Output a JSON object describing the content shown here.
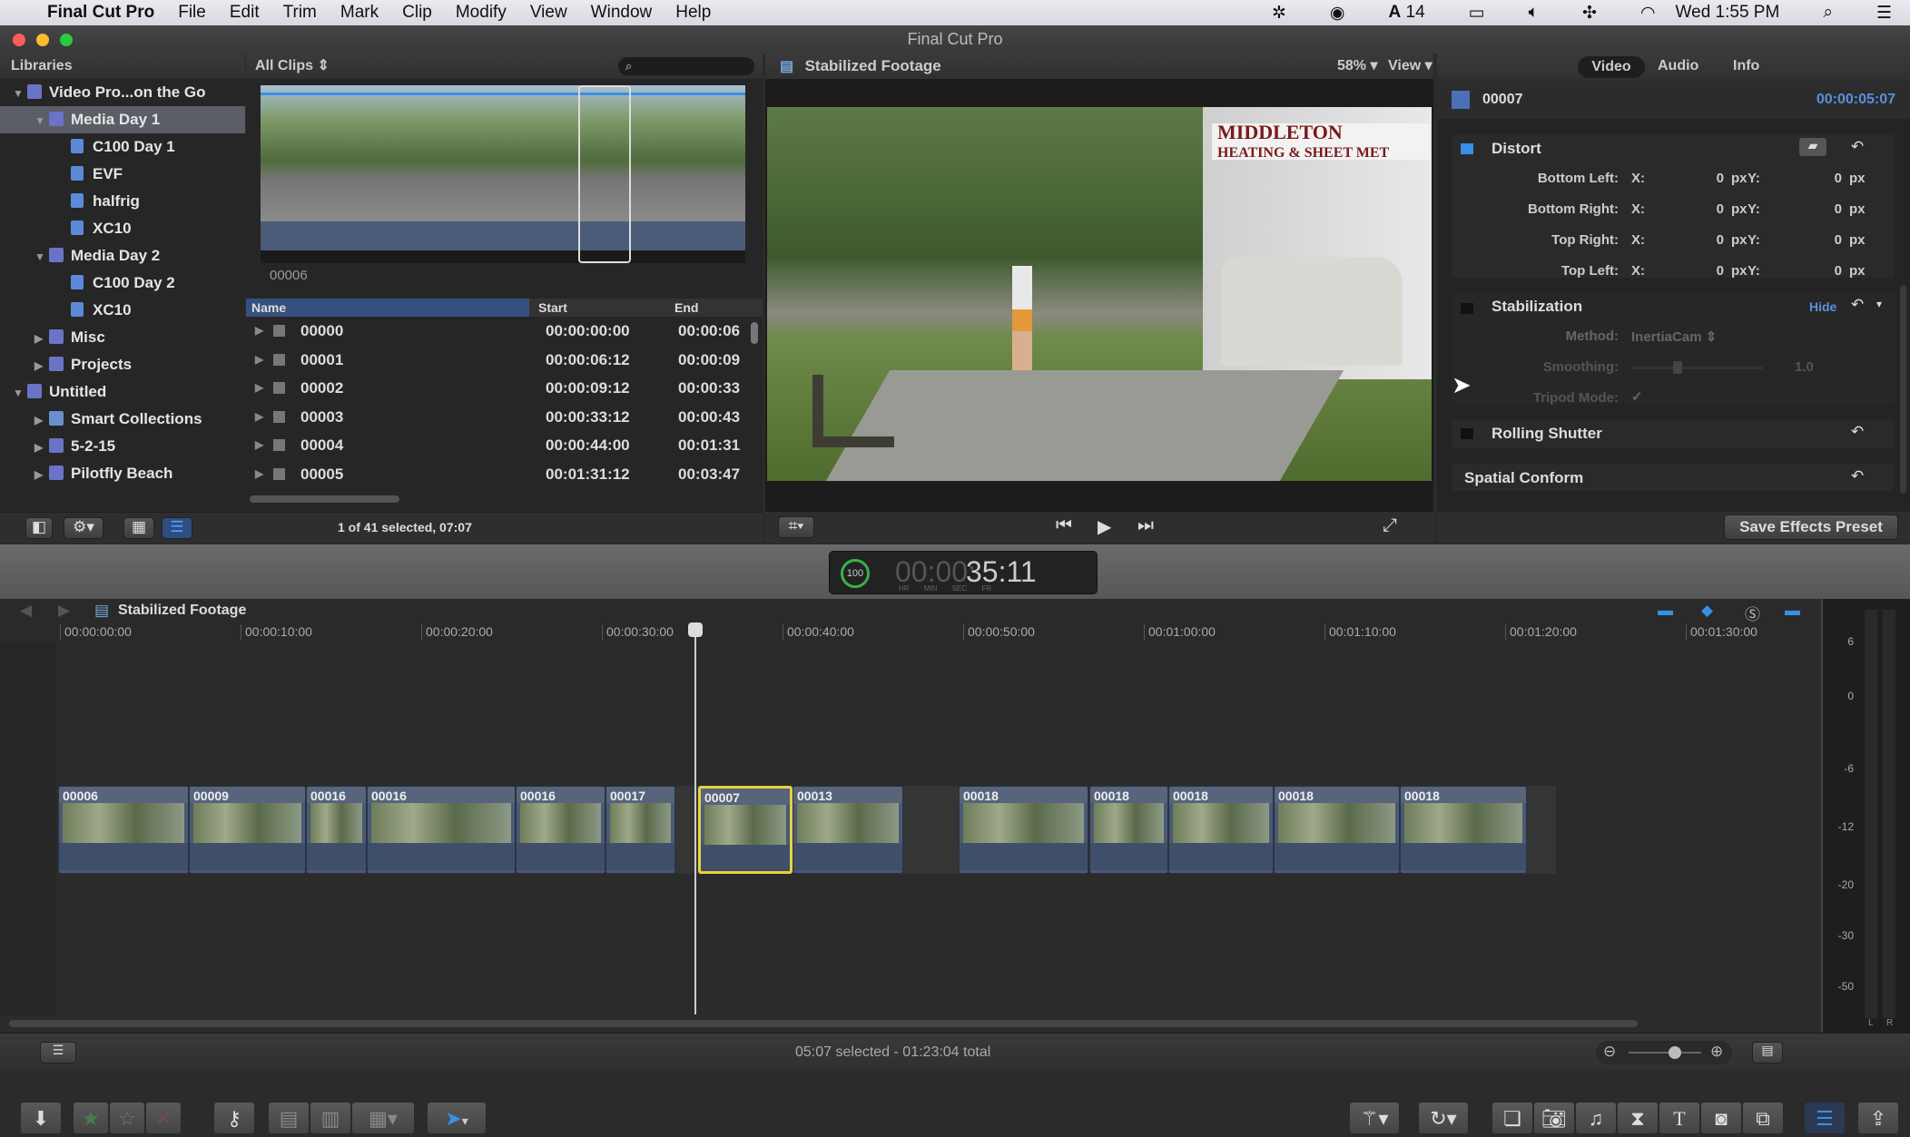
{
  "menubar": {
    "apple": "",
    "app": "Final Cut Pro",
    "items": [
      "File",
      "Edit",
      "Trim",
      "Mark",
      "Clip",
      "Modify",
      "View",
      "Window",
      "Help"
    ],
    "adobe_count": "14",
    "clock": "Wed 1:55 PM"
  },
  "window": {
    "title": "Final Cut Pro"
  },
  "libraries": {
    "header": "Libraries",
    "items": [
      {
        "label": "Video Pro...on the Go",
        "type": "library",
        "level": 0,
        "open": true
      },
      {
        "label": "Media Day 1",
        "type": "event-group",
        "level": 1,
        "open": true,
        "selected": true
      },
      {
        "label": "C100 Day 1",
        "type": "event",
        "level": 2
      },
      {
        "label": "EVF",
        "type": "event",
        "level": 2
      },
      {
        "label": "halfrig",
        "type": "event",
        "level": 2
      },
      {
        "label": "XC10",
        "type": "event",
        "level": 2
      },
      {
        "label": "Media Day 2",
        "type": "event-group",
        "level": 1,
        "open": true
      },
      {
        "label": "C100 Day 2",
        "type": "event",
        "level": 2
      },
      {
        "label": "XC10",
        "type": "event",
        "level": 2
      },
      {
        "label": "Misc",
        "type": "event-group",
        "level": 1
      },
      {
        "label": "Projects",
        "type": "event-group",
        "level": 1
      },
      {
        "label": "Untitled",
        "type": "library",
        "level": 0,
        "open": true
      },
      {
        "label": "Smart Collections",
        "type": "folder",
        "level": 1
      },
      {
        "label": "5-2-15",
        "type": "event-group",
        "level": 1
      },
      {
        "label": "Pilotfly Beach",
        "type": "event-group",
        "level": 1
      }
    ]
  },
  "browser": {
    "filter": "All Clips",
    "search_placeholder": "",
    "filmstrip_label": "00006",
    "columns": [
      "Name",
      "Start",
      "End"
    ],
    "rows": [
      [
        "00000",
        "00:00:00:00",
        "00:00:06"
      ],
      [
        "00001",
        "00:00:06:12",
        "00:00:09"
      ],
      [
        "00002",
        "00:00:09:12",
        "00:00:33"
      ],
      [
        "00003",
        "00:00:33:12",
        "00:00:43"
      ],
      [
        "00004",
        "00:00:44:00",
        "00:01:31"
      ],
      [
        "00005",
        "00:01:31:12",
        "00:03:47"
      ]
    ],
    "status": "1 of 41 selected, 07:07"
  },
  "viewer": {
    "title": "Stabilized Footage",
    "zoom": "58%",
    "view_label": "View"
  },
  "inspector": {
    "tabs": [
      "Video",
      "Audio",
      "Info"
    ],
    "active_tab": "Video",
    "clip_name": "00007",
    "duration": "00:00:05:07",
    "distort": {
      "title": "Distort",
      "rows": [
        {
          "label": "Bottom Left:",
          "x": "0",
          "y": "0"
        },
        {
          "label": "Bottom Right:",
          "x": "0",
          "y": "0"
        },
        {
          "label": "Top Right:",
          "x": "0",
          "y": "0"
        },
        {
          "label": "Top Left:",
          "x": "0",
          "y": "0"
        }
      ],
      "x_label": "X:",
      "y_label": "Y:",
      "unit": "px"
    },
    "stabilization": {
      "title": "Stabilization",
      "hide": "Hide",
      "method_label": "Method:",
      "method": "InertiaCam",
      "smoothing_label": "Smoothing:",
      "smoothing": "1.0",
      "smoothing_fraction": 0.35,
      "tripod_label": "Tripod Mode:",
      "tripod": "✓"
    },
    "rolling_shutter": "Rolling Shutter",
    "spatial_conform": "Spatial Conform",
    "save_preset": "Save Effects Preset"
  },
  "toolbar": {
    "timecode_pct": "100",
    "timecode_dim": "00:00:",
    "timecode": "35:11",
    "tc_units": [
      "HR",
      "MIN",
      "SEC",
      "FR"
    ]
  },
  "timeline": {
    "project": "Stabilized Footage",
    "ruler": [
      "00:00:00:00",
      "00:00:10:00",
      "00:00:20:00",
      "00:00:30:00",
      "00:00:40:00",
      "00:00:50:00",
      "00:01:00:00",
      "00:01:10:00",
      "00:01:20:00",
      "00:01:30:00"
    ],
    "clips": [
      "00006",
      "00009",
      "00016",
      "00016",
      "00016",
      "00017",
      "00007",
      "00013",
      "00018",
      "00018",
      "00018",
      "00018",
      "00018"
    ],
    "selected_clip": "00007",
    "status": "05:07 selected - 01:23:04 total"
  },
  "meters": {
    "scale": [
      "6",
      "0",
      "-6",
      "-12",
      "-20",
      "-30",
      "-50"
    ],
    "channels": [
      "L",
      "R"
    ]
  },
  "colors": {
    "accent": "#3a7bd5",
    "selection": "#e8d23c",
    "timecode_blue": "#5b8ee0"
  }
}
